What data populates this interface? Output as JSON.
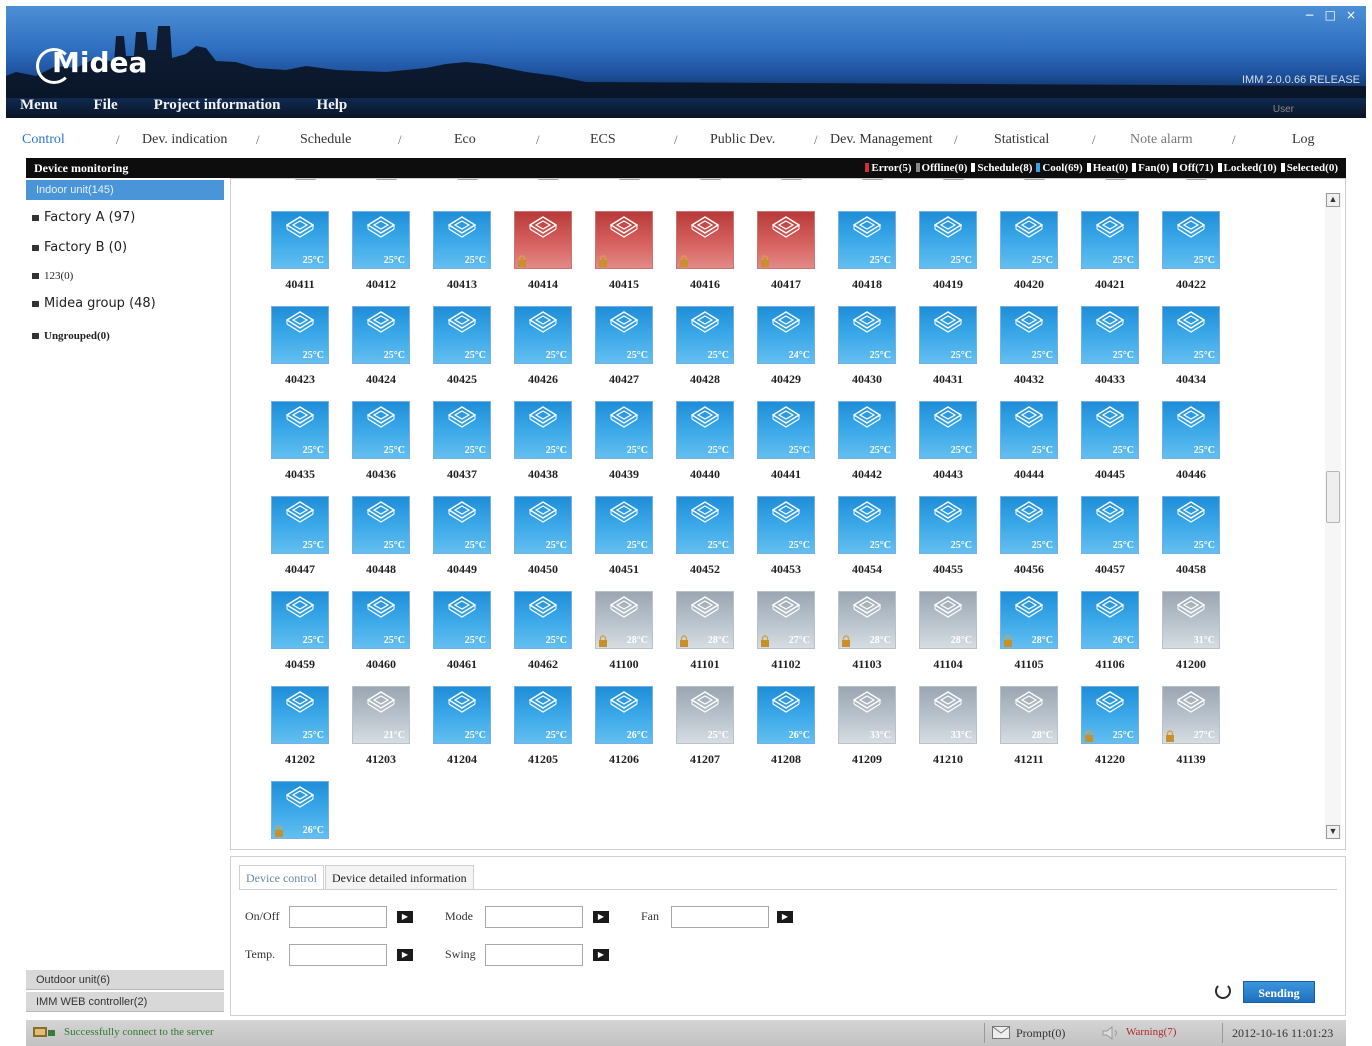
{
  "window": {
    "brand": "Midea",
    "version": "IMM 2.0.0.66 RELEASE",
    "user_label": "User",
    "controls": [
      "−",
      "□",
      "×"
    ]
  },
  "menu": [
    "Menu",
    "File",
    "Project information",
    "Help"
  ],
  "nav_tabs": [
    "Control",
    "Dev. indication",
    "Schedule",
    "Eco",
    "ECS",
    "Public Dev.",
    "Dev. Management",
    "Statistical",
    "Note alarm",
    "Log"
  ],
  "sidebar": {
    "header": "Device monitoring",
    "selected": "Indoor unit(145)",
    "groups": [
      "Factory A (97)",
      "Factory B (0)",
      "123(0)",
      "Midea group (48)",
      "Ungrouped(0)"
    ],
    "footer_items": [
      "Outdoor unit(6)",
      "IMM WEB controller(2)"
    ]
  },
  "status_legend": [
    {
      "label": "Error(5)",
      "color": "#d03030"
    },
    {
      "label": "Offline(0)",
      "color": "#888888"
    },
    {
      "label": "Schedule(8)",
      "color": "#ffffff"
    },
    {
      "label": "Cool(69)",
      "color": "#3aa0e8"
    },
    {
      "label": "Heat(0)",
      "color": "#ffffff"
    },
    {
      "label": "Fan(0)",
      "color": "#ffffff"
    },
    {
      "label": "Off(71)",
      "color": "#ffffff"
    },
    {
      "label": "Locked(10)",
      "color": "#ffffff"
    },
    {
      "label": "Selected(0)",
      "color": "#ffffff"
    }
  ],
  "devices": [
    {
      "id": "40411",
      "state": "on",
      "temp": "25°C",
      "locked": false
    },
    {
      "id": "40412",
      "state": "on",
      "temp": "25°C",
      "locked": false
    },
    {
      "id": "40413",
      "state": "on",
      "temp": "25°C",
      "locked": false
    },
    {
      "id": "40414",
      "state": "error",
      "temp": "",
      "locked": true
    },
    {
      "id": "40415",
      "state": "error",
      "temp": "",
      "locked": true
    },
    {
      "id": "40416",
      "state": "error",
      "temp": "",
      "locked": true
    },
    {
      "id": "40417",
      "state": "error",
      "temp": "",
      "locked": true
    },
    {
      "id": "40418",
      "state": "on",
      "temp": "25°C",
      "locked": false
    },
    {
      "id": "40419",
      "state": "on",
      "temp": "25°C",
      "locked": false
    },
    {
      "id": "40420",
      "state": "on",
      "temp": "25°C",
      "locked": false
    },
    {
      "id": "40421",
      "state": "on",
      "temp": "25°C",
      "locked": false
    },
    {
      "id": "40422",
      "state": "on",
      "temp": "25°C",
      "locked": false
    },
    {
      "id": "40423",
      "state": "on",
      "temp": "25°C",
      "locked": false
    },
    {
      "id": "40424",
      "state": "on",
      "temp": "25°C",
      "locked": false
    },
    {
      "id": "40425",
      "state": "on",
      "temp": "25°C",
      "locked": false
    },
    {
      "id": "40426",
      "state": "on",
      "temp": "25°C",
      "locked": false
    },
    {
      "id": "40427",
      "state": "on",
      "temp": "25°C",
      "locked": false
    },
    {
      "id": "40428",
      "state": "on",
      "temp": "25°C",
      "locked": false
    },
    {
      "id": "40429",
      "state": "on",
      "temp": "24°C",
      "locked": false
    },
    {
      "id": "40430",
      "state": "on",
      "temp": "25°C",
      "locked": false
    },
    {
      "id": "40431",
      "state": "on",
      "temp": "25°C",
      "locked": false
    },
    {
      "id": "40432",
      "state": "on",
      "temp": "25°C",
      "locked": false
    },
    {
      "id": "40433",
      "state": "on",
      "temp": "25°C",
      "locked": false
    },
    {
      "id": "40434",
      "state": "on",
      "temp": "25°C",
      "locked": false
    },
    {
      "id": "40435",
      "state": "on",
      "temp": "25°C",
      "locked": false
    },
    {
      "id": "40436",
      "state": "on",
      "temp": "25°C",
      "locked": false
    },
    {
      "id": "40437",
      "state": "on",
      "temp": "25°C",
      "locked": false
    },
    {
      "id": "40438",
      "state": "on",
      "temp": "25°C",
      "locked": false
    },
    {
      "id": "40439",
      "state": "on",
      "temp": "25°C",
      "locked": false
    },
    {
      "id": "40440",
      "state": "on",
      "temp": "25°C",
      "locked": false
    },
    {
      "id": "40441",
      "state": "on",
      "temp": "25°C",
      "locked": false
    },
    {
      "id": "40442",
      "state": "on",
      "temp": "25°C",
      "locked": false
    },
    {
      "id": "40443",
      "state": "on",
      "temp": "25°C",
      "locked": false
    },
    {
      "id": "40444",
      "state": "on",
      "temp": "25°C",
      "locked": false
    },
    {
      "id": "40445",
      "state": "on",
      "temp": "25°C",
      "locked": false
    },
    {
      "id": "40446",
      "state": "on",
      "temp": "25°C",
      "locked": false
    },
    {
      "id": "40447",
      "state": "on",
      "temp": "25°C",
      "locked": false
    },
    {
      "id": "40448",
      "state": "on",
      "temp": "25°C",
      "locked": false
    },
    {
      "id": "40449",
      "state": "on",
      "temp": "25°C",
      "locked": false
    },
    {
      "id": "40450",
      "state": "on",
      "temp": "25°C",
      "locked": false
    },
    {
      "id": "40451",
      "state": "on",
      "temp": "25°C",
      "locked": false
    },
    {
      "id": "40452",
      "state": "on",
      "temp": "25°C",
      "locked": false
    },
    {
      "id": "40453",
      "state": "on",
      "temp": "25°C",
      "locked": false
    },
    {
      "id": "40454",
      "state": "on",
      "temp": "25°C",
      "locked": false
    },
    {
      "id": "40455",
      "state": "on",
      "temp": "25°C",
      "locked": false
    },
    {
      "id": "40456",
      "state": "on",
      "temp": "25°C",
      "locked": false
    },
    {
      "id": "40457",
      "state": "on",
      "temp": "25°C",
      "locked": false
    },
    {
      "id": "40458",
      "state": "on",
      "temp": "25°C",
      "locked": false
    },
    {
      "id": "40459",
      "state": "on",
      "temp": "25°C",
      "locked": false
    },
    {
      "id": "40460",
      "state": "on",
      "temp": "25°C",
      "locked": false
    },
    {
      "id": "40461",
      "state": "on",
      "temp": "25°C",
      "locked": false
    },
    {
      "id": "40462",
      "state": "on",
      "temp": "25°C",
      "locked": false
    },
    {
      "id": "41100",
      "state": "off",
      "temp": "28°C",
      "locked": true
    },
    {
      "id": "41101",
      "state": "off",
      "temp": "28°C",
      "locked": true
    },
    {
      "id": "41102",
      "state": "off",
      "temp": "27°C",
      "locked": true
    },
    {
      "id": "41103",
      "state": "off",
      "temp": "28°C",
      "locked": true
    },
    {
      "id": "41104",
      "state": "off",
      "temp": "28°C",
      "locked": false
    },
    {
      "id": "41105",
      "state": "on",
      "temp": "28°C",
      "locked": true
    },
    {
      "id": "41106",
      "state": "on",
      "temp": "26°C",
      "locked": false
    },
    {
      "id": "41200",
      "state": "off",
      "temp": "31°C",
      "locked": false
    },
    {
      "id": "41202",
      "state": "on",
      "temp": "25°C",
      "locked": false
    },
    {
      "id": "41203",
      "state": "off",
      "temp": "21°C",
      "locked": false
    },
    {
      "id": "41204",
      "state": "on",
      "temp": "25°C",
      "locked": false
    },
    {
      "id": "41205",
      "state": "on",
      "temp": "25°C",
      "locked": false
    },
    {
      "id": "41206",
      "state": "on",
      "temp": "26°C",
      "locked": false
    },
    {
      "id": "41207",
      "state": "off",
      "temp": "25°C",
      "locked": false
    },
    {
      "id": "41208",
      "state": "on",
      "temp": "26°C",
      "locked": false
    },
    {
      "id": "41209",
      "state": "off",
      "temp": "33°C",
      "locked": false
    },
    {
      "id": "41210",
      "state": "off",
      "temp": "33°C",
      "locked": false
    },
    {
      "id": "41211",
      "state": "off",
      "temp": "28°C",
      "locked": false
    },
    {
      "id": "41220",
      "state": "on",
      "temp": "25°C",
      "locked": true
    },
    {
      "id": "41139",
      "state": "off",
      "temp": "27°C",
      "locked": true
    },
    {
      "id": "",
      "state": "on",
      "temp": "26°C",
      "locked": true
    }
  ],
  "control_panel": {
    "tabs": [
      "Device control",
      "Device detailed information"
    ],
    "fields": {
      "onoff": {
        "label": "On/Off",
        "value": ""
      },
      "mode": {
        "label": "Mode",
        "value": ""
      },
      "fan": {
        "label": "Fan",
        "value": ""
      },
      "temp": {
        "label": "Temp.",
        "value": ""
      },
      "swing": {
        "label": "Swing",
        "value": ""
      }
    },
    "send_label": "Sending"
  },
  "footer": {
    "connection": "Successfully connect to the server",
    "prompt": "Prompt(0)",
    "warning": "Warning(7)",
    "datetime": "2012-10-16 11:01:23"
  },
  "colors": {
    "accent": "#2a78c8",
    "cool": "#3aa0e8",
    "error": "#d03030",
    "off": "#a8b2bc"
  }
}
